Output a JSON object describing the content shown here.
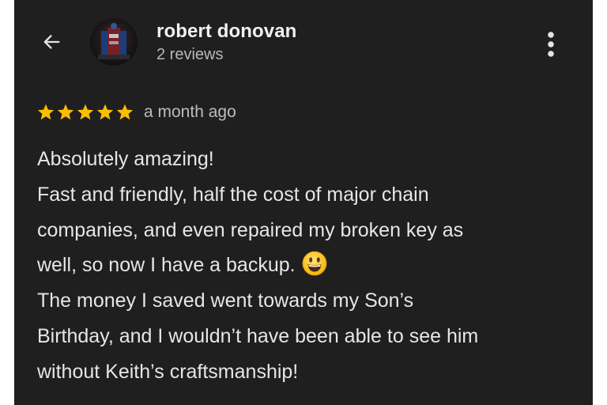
{
  "reviewer": {
    "name": "robert donovan",
    "review_count": "2 reviews"
  },
  "review": {
    "rating": 5,
    "rating_max": 5,
    "time_ago": "a month ago",
    "lines": [
      "Absolutely amazing!",
      "Fast and friendly, half the cost of major chain",
      "companies, and even repaired my broken key as",
      "well, so now I have a backup.",
      "The money I saved went towards my Son’s",
      "Birthday, and I wouldn’t have been able to see him",
      "without Keith’s craftsmanship!"
    ],
    "emoji": "grinning-face-icon"
  },
  "icons": {
    "back": "arrow-left-icon",
    "menu": "more-vertical-icon",
    "star": "star-icon"
  },
  "colors": {
    "background": "#1f1f1f",
    "star": "#fbbc04",
    "text": "#e6e6e6",
    "secondary_text": "#b8b8b8"
  }
}
